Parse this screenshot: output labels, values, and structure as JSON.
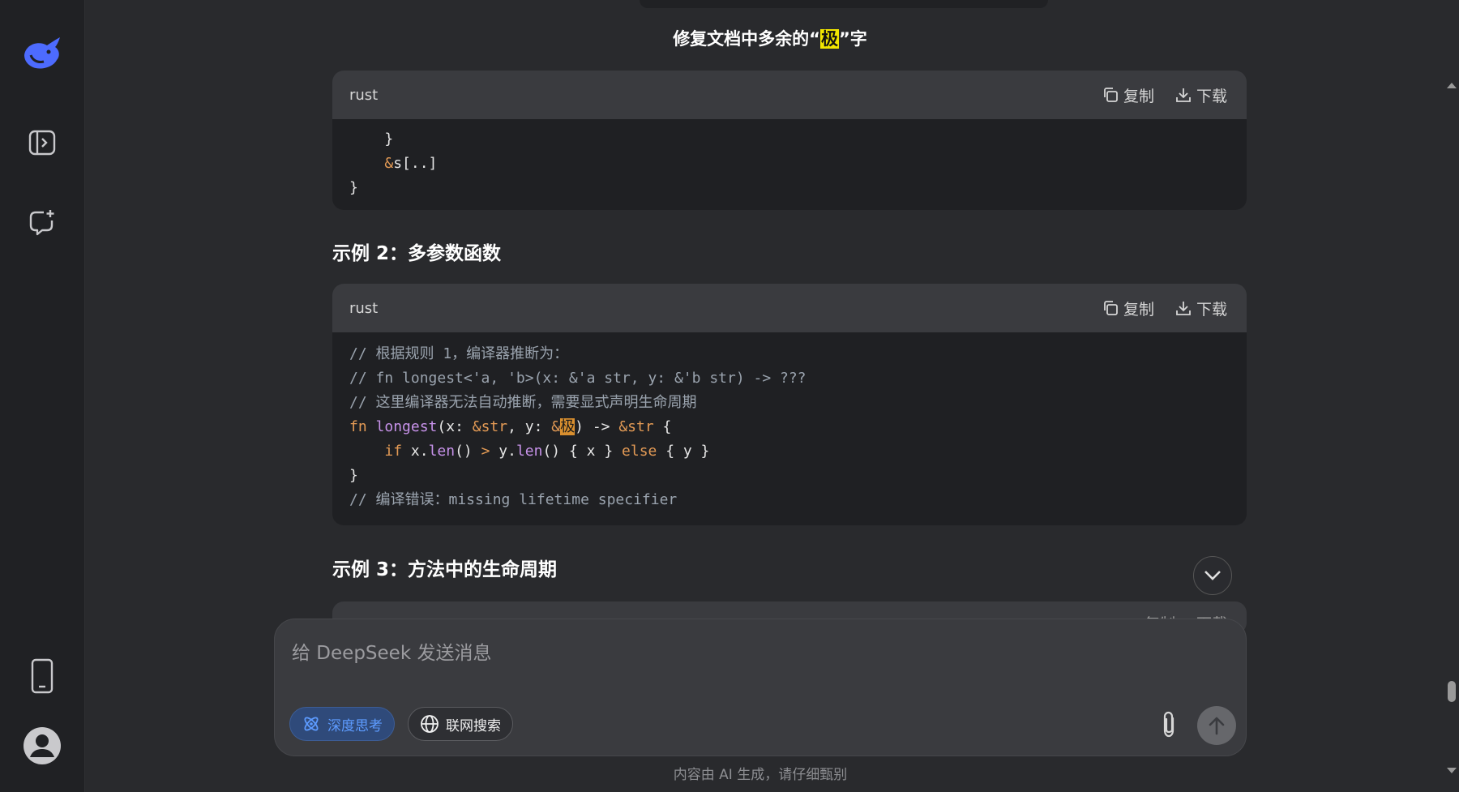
{
  "chat": {
    "title_prefix": "修复文档中多余的“",
    "title_highlight": "极",
    "title_suffix": "”字"
  },
  "code_block_1": {
    "lang": "rust",
    "copy_label": "复制",
    "download_label": "下载",
    "lines": [
      "    }",
      "    &s[..]",
      "}"
    ]
  },
  "heading_2": "示例 2：多参数函数",
  "code_block_2": {
    "lang": "rust",
    "copy_label": "复制",
    "download_label": "下载",
    "comment_1": "// 根据规则 1，编译器推断为：",
    "comment_2": "// fn longest<'a, 'b>(x: &'a str, y: &'b str) -> ???",
    "comment_3": "// 这里编译器无法自动推断，需要显式声明生命周期",
    "selected_char": "极",
    "comment_4": "// 编译错误：missing lifetime specifier"
  },
  "heading_3": "示例 3：方法中的生命周期",
  "code_block_3": {
    "copy_label": "复制",
    "download_label": "下载"
  },
  "composer": {
    "placeholder": "给 DeepSeek 发送消息",
    "deep_think_label": "深度思考",
    "web_search_label": "联网搜索"
  },
  "footer_note": "内容由 AI 生成，请仔细甄别",
  "colors": {
    "background": "#292a2d",
    "sidebar": "#202124",
    "accent_blue": "#4d6bfe",
    "code_bg": "#1f2023",
    "highlight_yellow": "#f2e600"
  },
  "icons": {
    "logo": "deepseek-whale-logo",
    "sidebar_toggle": "sidebar-open-icon",
    "new_chat": "new-chat-icon",
    "mobile": "mobile-app-icon",
    "profile": "user-avatar-icon"
  }
}
